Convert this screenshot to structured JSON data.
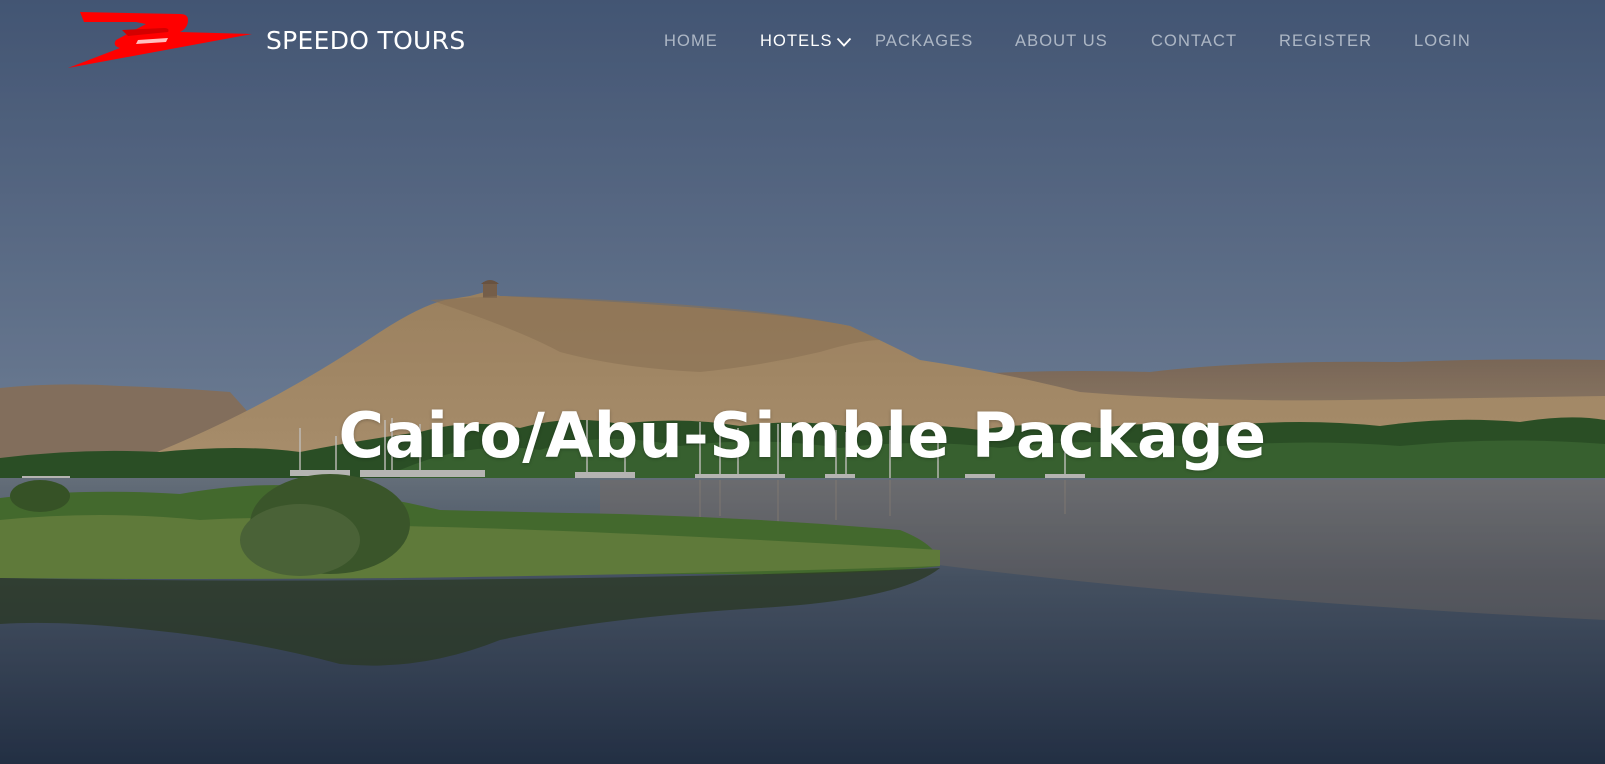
{
  "brand": {
    "name": "SPEEDO TOURS",
    "logo_icon": "speedo-wing-logo-icon",
    "logo_color": "#ff0000"
  },
  "nav": {
    "items": [
      {
        "label": "HOME",
        "active": false
      },
      {
        "label": "HOTELS",
        "active": true,
        "dropdown_icon": "chevron-down-icon"
      },
      {
        "label": "PACKAGES",
        "active": false
      },
      {
        "label": "ABOUT US",
        "active": false
      },
      {
        "label": "CONTACT",
        "active": false
      },
      {
        "label": "REGISTER",
        "active": false
      },
      {
        "label": "LOGIN",
        "active": false
      }
    ]
  },
  "hero": {
    "title": "Cairo/Abu-Simble Package",
    "background": "nile-river-desert-landscape"
  },
  "colors": {
    "text": "#ffffff",
    "nav_inactive": "#c9d0d8",
    "logo": "#ff0000"
  }
}
